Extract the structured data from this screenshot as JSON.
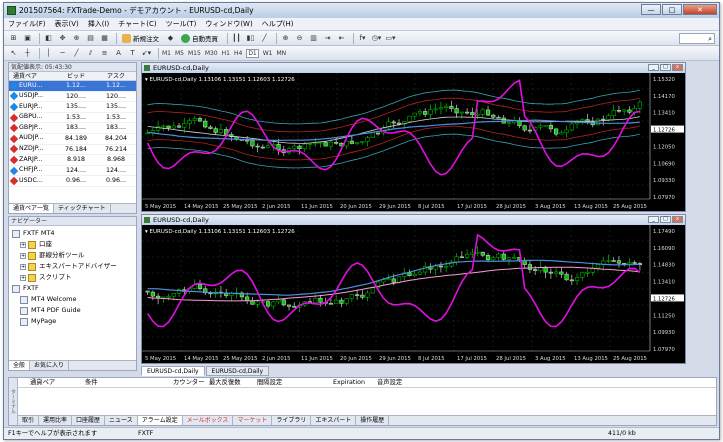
{
  "window": {
    "title": "201507564: FXTrade-Demo - デモアカウント - EURUSD-cd,Daily",
    "min": "—",
    "max": "□",
    "close": "✕"
  },
  "menu": [
    "ファイル(F)",
    "表示(V)",
    "挿入(I)",
    "チャート(C)",
    "ツール(T)",
    "ウィンドウ(W)",
    "ヘルプ(H)"
  ],
  "toolbar": {
    "new_order": "新規注文",
    "auto_trade": "自動売買"
  },
  "timeframes": [
    "M1",
    "M5",
    "M15",
    "M30",
    "H1",
    "H4",
    "D1",
    "W1",
    "MN"
  ],
  "market_watch": {
    "title": "気配値表示: 05:43:30",
    "headers": [
      "通貨ペア",
      "ビッド",
      "アスク"
    ],
    "rows": [
      {
        "symbol": "EURU...",
        "bid": "1.12...",
        "ask": "1.12...",
        "color": "#1e88e5"
      },
      {
        "symbol": "USDJP...",
        "bid": "120....",
        "ask": "120....",
        "color": "#1e88e5"
      },
      {
        "symbol": "EURJP...",
        "bid": "135....",
        "ask": "135....",
        "color": "#1e88e5"
      },
      {
        "symbol": "GBPU...",
        "bid": "1.53...",
        "ask": "1.53...",
        "color": "#d32f2f"
      },
      {
        "symbol": "GBPJP...",
        "bid": "183....",
        "ask": "183....",
        "color": "#d32f2f"
      },
      {
        "symbol": "AUDJP...",
        "bid": "84.189",
        "ask": "84.204",
        "color": "#d32f2f"
      },
      {
        "symbol": "NZDJP...",
        "bid": "76.184",
        "ask": "76.214",
        "color": "#d32f2f"
      },
      {
        "symbol": "ZARJP...",
        "bid": "8.918",
        "ask": "8.968",
        "color": "#d32f2f"
      },
      {
        "symbol": "CHFJP...",
        "bid": "124....",
        "ask": "124....",
        "color": "#1e88e5"
      },
      {
        "symbol": "USDC...",
        "bid": "0.96...",
        "ask": "0.96...",
        "color": "#d32f2f"
      }
    ],
    "tabs": [
      "通貨ペア一覧",
      "ティックチャート"
    ]
  },
  "navigator": {
    "title": "ナビゲーター",
    "items": [
      {
        "label": "FXTF MT4",
        "level": 0
      },
      {
        "label": "口座",
        "level": 1
      },
      {
        "label": "罫線分析ツール",
        "level": 1
      },
      {
        "label": "エキスパートアドバイザー",
        "level": 1
      },
      {
        "label": "スクリプト",
        "level": 1
      },
      {
        "label": "FXTF",
        "level": 0
      },
      {
        "label": "MT4 Welcome",
        "level": 1
      },
      {
        "label": "MT4 PDF Guide",
        "level": 1
      },
      {
        "label": "MyPage",
        "level": 1
      }
    ],
    "tabs": [
      "全般",
      "お気に入り"
    ]
  },
  "charts": [
    {
      "title": "EURUSD-cd,Daily",
      "info": "▾ EURUSD-cd,Daily  1.13106  1.13151  1.12603  1.12726",
      "yticks": [
        "1.15320",
        "1.14170",
        "1.13410",
        "1.12726",
        "1.12050",
        "1.10690",
        "1.09330",
        "1.07970"
      ],
      "xticks": [
        "5 May 2015",
        "14 May 2015",
        "25 May 2015",
        "2 Jun 2015",
        "11 Jun 2015",
        "20 Jun 2015",
        "29 Jun 2015",
        "8 Jul 2015",
        "17 Jul 2015",
        "28 Jul 2015",
        "3 Aug 2015",
        "13 Aug 2015",
        "25 Aug 2015"
      ]
    },
    {
      "title": "EURUSD-cd,Daily",
      "info": "▾ EURUSD-cd,Daily  1.13106  1.13151  1.12603  1.12726",
      "yticks": [
        "1.17490",
        "1.16090",
        "1.14830",
        "1.13410",
        "1.12726",
        "1.11250",
        "1.09930",
        "1.07970"
      ],
      "xticks": [
        "5 May 2015",
        "14 May 2015",
        "25 May 2015",
        "2 Jun 2015",
        "11 Jun 2015",
        "20 Jun 2015",
        "29 Jun 2015",
        "8 Jul 2015",
        "17 Jul 2015",
        "28 Jul 2015",
        "3 Aug 2015",
        "13 Aug 2015",
        "25 Aug 2015"
      ]
    }
  ],
  "chart_tabs": [
    "EURUSD-cd,Daily",
    "EURUSD-cd,Daily"
  ],
  "terminal": {
    "side_label": "ターミナル",
    "headers": [
      "通貨ペア",
      "条件",
      "カウンター",
      "最大反復数",
      "間隔設定",
      "Expiration",
      "音声設定"
    ],
    "tabs": [
      "取引",
      "運用比率",
      "口座履歴",
      "ニュース",
      "アラーム設定",
      "メールボックス",
      "マーケット",
      "ライブラリ",
      "エキスパート",
      "操作履歴"
    ]
  },
  "status": {
    "help": "F1キーでヘルプが表示されます",
    "profile": "FXTF",
    "traffic": "411/0 kb"
  },
  "colors": {
    "bull": "#00c800",
    "bear": "#ffffff",
    "magenta": "#e010e0",
    "band_red": "#b22222",
    "band_cyan": "#3aa0b0",
    "ma_blue": "#4f8fe0",
    "ma_white": "#d0d0d0",
    "ma_pink": "#ff9ad5",
    "price_tag": "#ffffff"
  }
}
